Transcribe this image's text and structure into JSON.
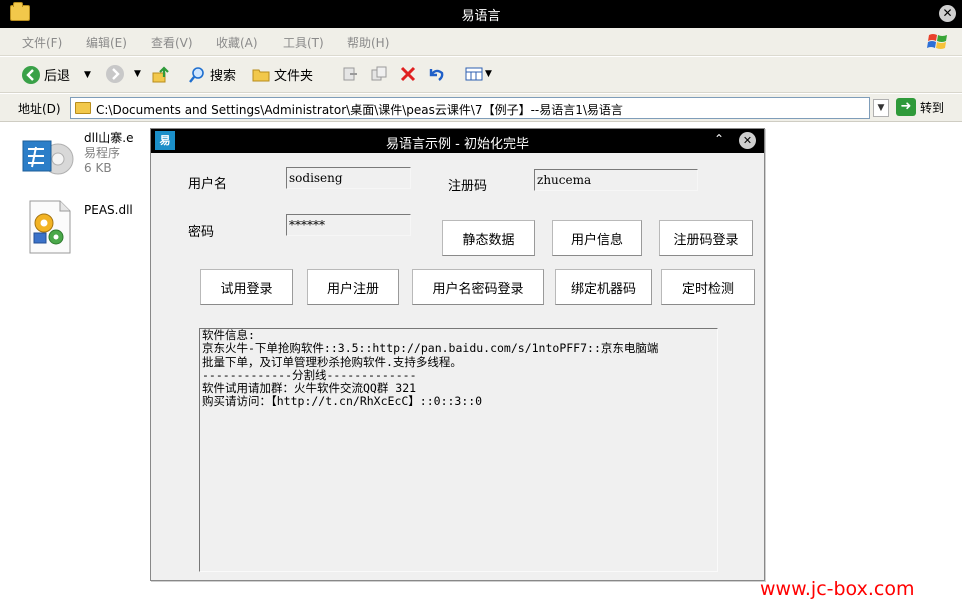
{
  "window": {
    "title": "易语言"
  },
  "menu": [
    "文件(F)",
    "编辑(E)",
    "查看(V)",
    "收藏(A)",
    "工具(T)",
    "帮助(H)"
  ],
  "toolbar": {
    "back": "后退",
    "search": "搜索",
    "folders": "文件夹"
  },
  "address": {
    "label": "地址(D)",
    "path": "C:\\Documents and Settings\\Administrator\\桌面\\课件\\peas云课件\\7【例子】--易语言1\\易语言",
    "go": "转到"
  },
  "files": [
    {
      "name": "dll山寨.e",
      "type": "易程序",
      "size": "6 KB"
    },
    {
      "name": "PEAS.dll"
    }
  ],
  "dialog": {
    "title": "易语言示例 - 初始化完毕",
    "username_label": "用户名",
    "username_value": "sodiseng",
    "regcode_label": "注册码",
    "regcode_value": "zhucema",
    "password_label": "密码",
    "password_value": "******",
    "buttons_row1": [
      "静态数据",
      "用户信息",
      "注册码登录"
    ],
    "buttons_row2": [
      "试用登录",
      "用户注册",
      "用户名密码登录",
      "绑定机器码",
      "定时检测"
    ],
    "memo_lines": [
      "软件信息:",
      "京东火牛-下单抢购软件::3.5::http://pan.baidu.com/s/1ntoPFF7::京东电脑端",
      "批量下单，及订单管理秒杀抢购软件.支持多线程。",
      "-------------分割线-------------",
      "软件试用请加群：火牛软件交流QQ群 321",
      "购买请访问：【http://t.cn/RhXcEcC】::0::3::0"
    ]
  },
  "watermark": "www.jc-box.com"
}
